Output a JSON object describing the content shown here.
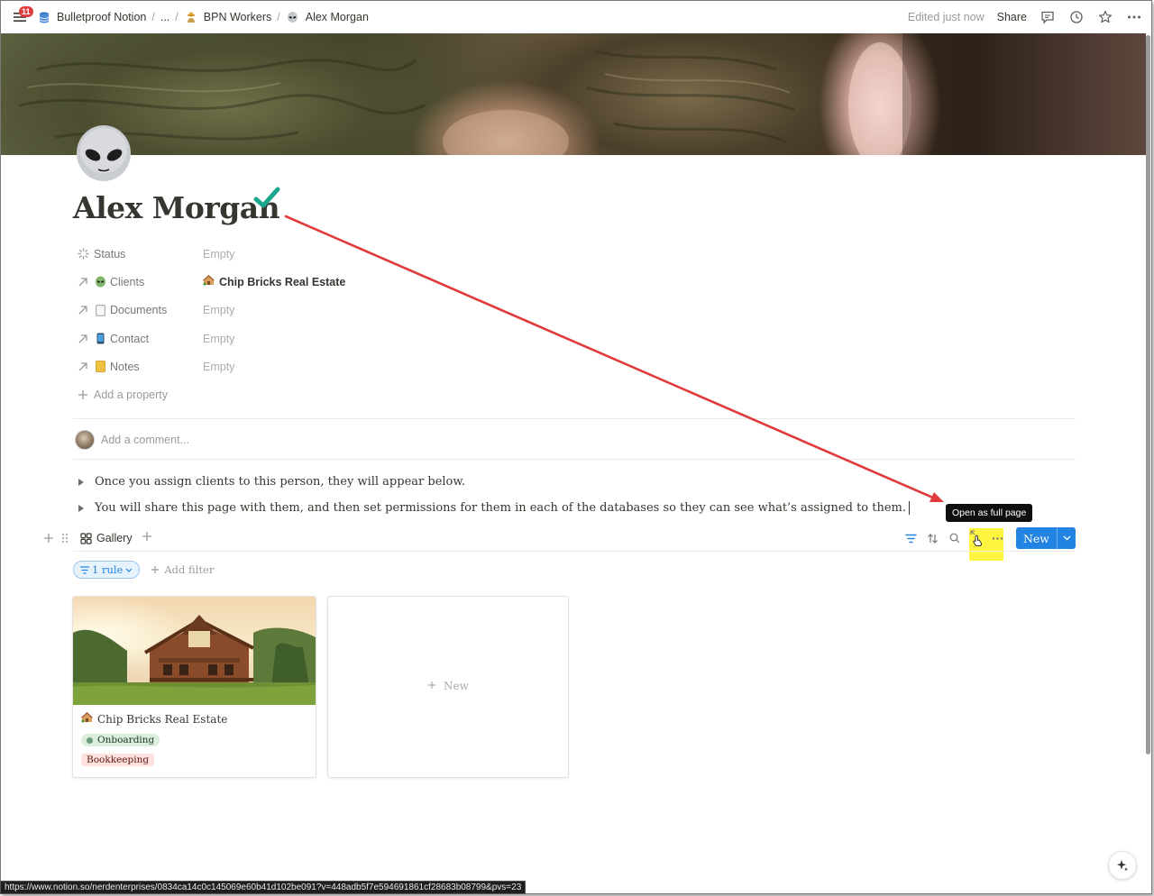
{
  "topbar": {
    "badge": "11",
    "breadcrumbs": [
      "Bulletproof Notion",
      "...",
      "BPN Workers",
      "Alex Morgan"
    ],
    "edited": "Edited just now",
    "share": "Share"
  },
  "page": {
    "title": "Alex Morgan",
    "properties": [
      {
        "name": "Status",
        "value": "Empty"
      },
      {
        "name": "Clients",
        "value": "Chip Bricks Real Estate"
      },
      {
        "name": "Documents",
        "value": "Empty"
      },
      {
        "name": "Contact",
        "value": "Empty"
      },
      {
        "name": "Notes",
        "value": "Empty"
      }
    ],
    "add_property": "Add a property",
    "comment_placeholder": "Add a comment...",
    "toggles": [
      "Once you assign clients to this person, they will appear below.",
      "You will share this page with them, and then set permissions for them in each of the databases so they can see what’s assigned to them."
    ]
  },
  "gallery": {
    "view_name": "Gallery",
    "tooltip": "Open as full page",
    "new_label": "New",
    "rule_label": "1 rule",
    "add_filter": "Add filter",
    "cards": [
      {
        "title": "Chip Bricks Real Estate",
        "tags": [
          "Onboarding",
          "Bookkeeping"
        ]
      }
    ],
    "new_card_label": "New"
  },
  "statusbar": {
    "url": "https://www.notion.so/nerdenterprises/0834ca14c0c145069e60b41d102be091?v=448adb5f7e594691861cf28683b08799&pvs=23"
  },
  "colors": {
    "accent": "#2383e2",
    "annotation_arrow": "#e03b3b",
    "highlight": "#fff200",
    "check": "#1aa68c"
  }
}
